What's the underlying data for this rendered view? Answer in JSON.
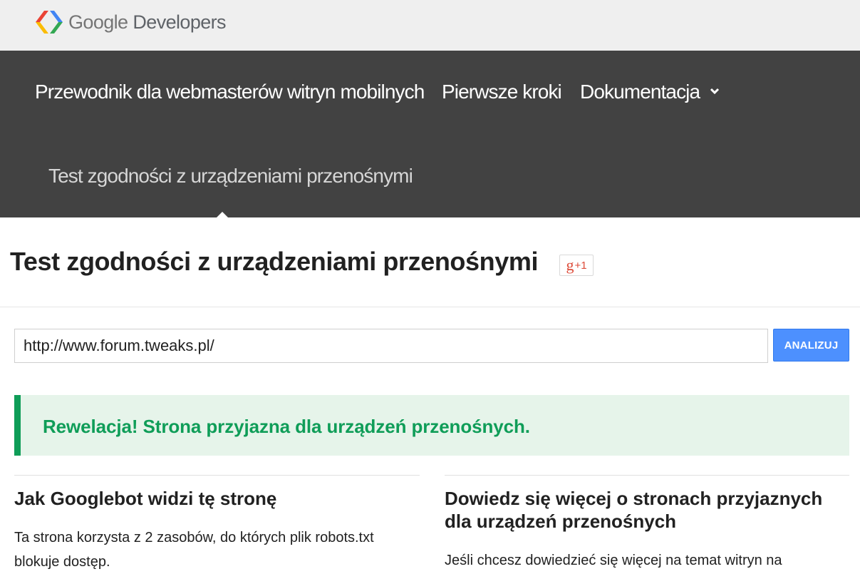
{
  "header": {
    "logo_google": "Google",
    "logo_developers": "Developers",
    "logo_colors": [
      "#ea4335",
      "#fbbc05",
      "#34a853",
      "#4285f4"
    ]
  },
  "nav": {
    "title": "Przewodnik dla webmasterów witryn mobilnych",
    "links": [
      {
        "label": "Pierwsze kroki"
      },
      {
        "label": "Dokumentacja",
        "icon": "chevron-down-icon"
      }
    ],
    "subnav_active": "Test zgodności z urządzeniami przenośnymi",
    "background": "#424242"
  },
  "page": {
    "title": "Test zgodności z urządzeniami przenośnymi",
    "gplus_g": "g",
    "gplus_label": "+1"
  },
  "form": {
    "url_value": "http://www.forum.tweaks.pl/",
    "analyze_label": "ANALIZUJ",
    "button_color": "#4d90fe"
  },
  "result": {
    "message": "Rewelacja! Strona przyjazna dla urządzeń przenośnych.",
    "accent": "#0f9d58",
    "background": "#e6f4ea"
  },
  "columns": {
    "left": {
      "heading": "Jak Googlebot widzi tę stronę",
      "text": "Ta strona korzysta z 2 zasobów, do których plik robots.txt blokuje dostęp."
    },
    "right": {
      "heading": "Dowiedz się więcej o stronach przyjaznych dla urządzeń przenośnych",
      "text": "Jeśli chcesz dowiedzieć się więcej na temat witryn na"
    }
  }
}
